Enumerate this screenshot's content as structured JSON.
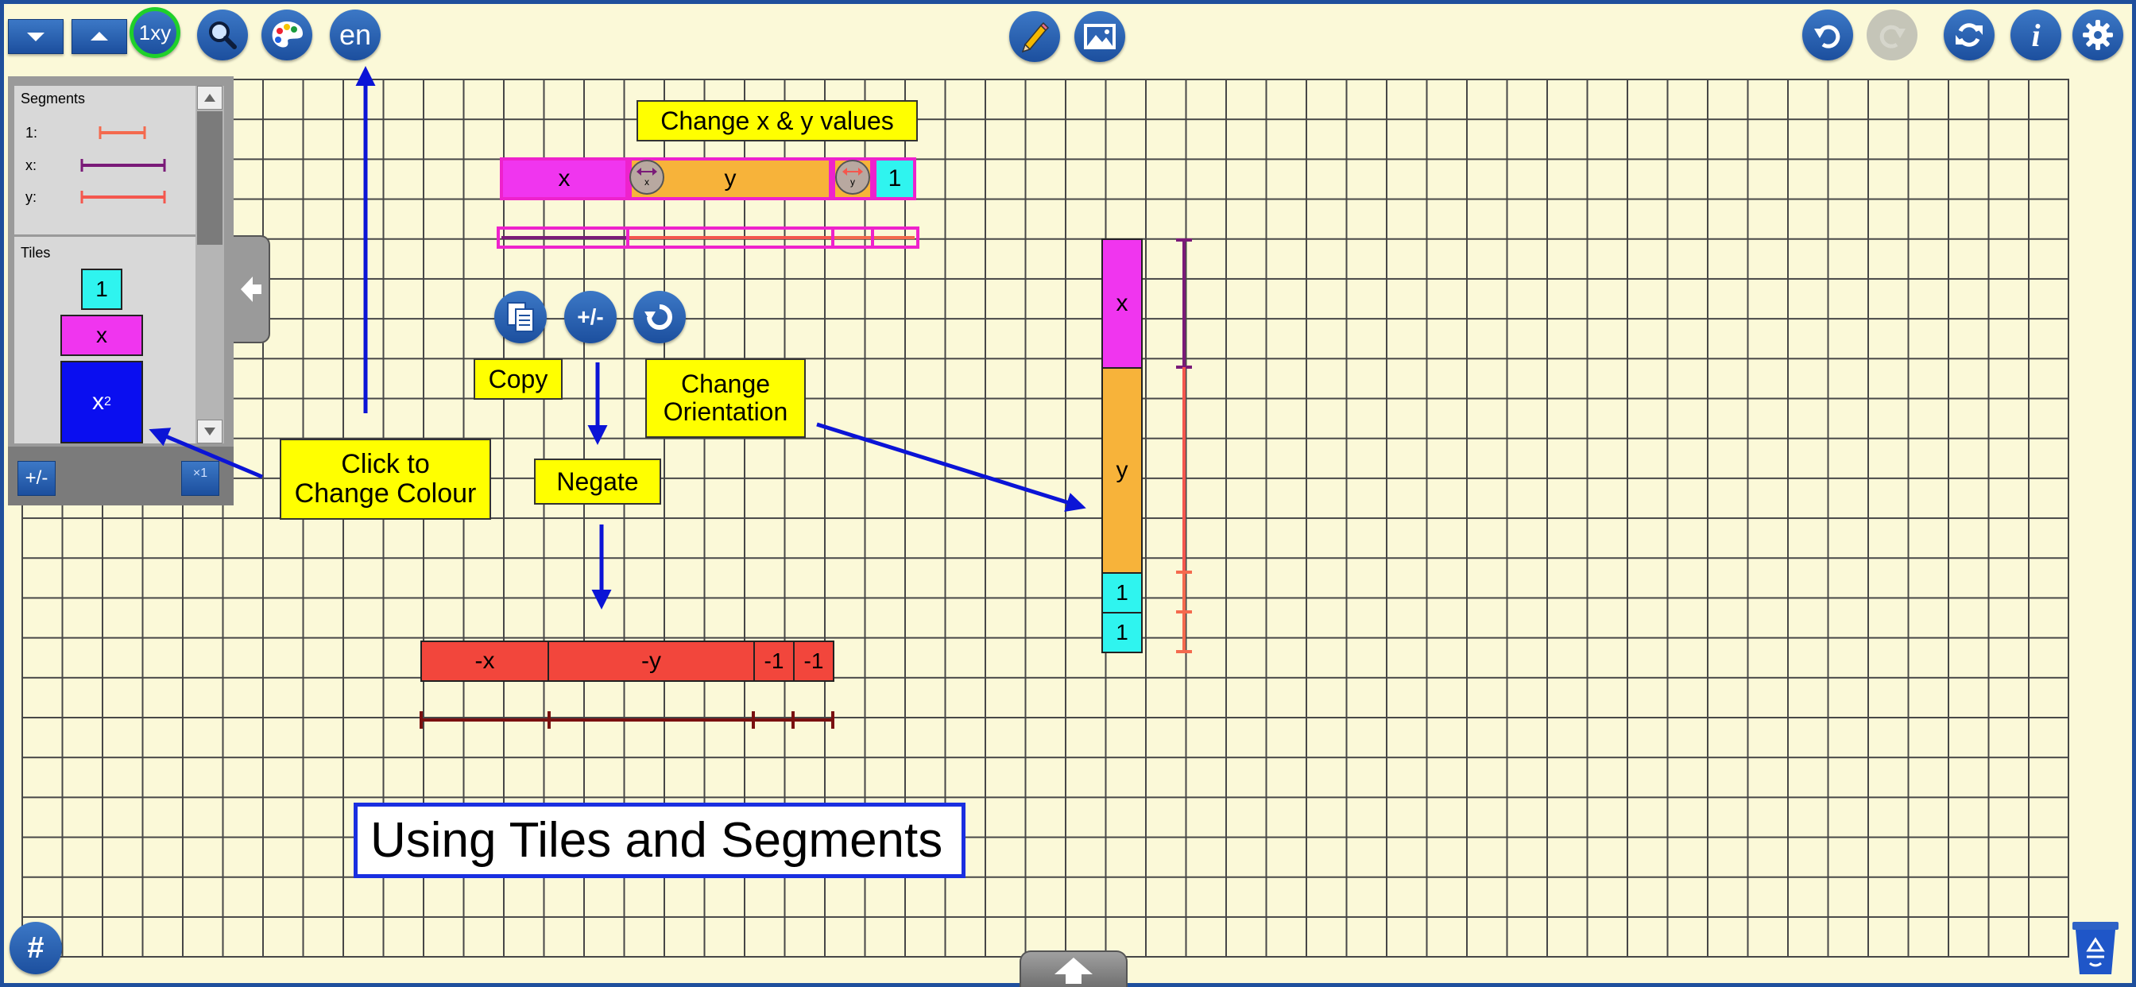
{
  "toolbar": {
    "expand_down_icon": "triangle-down-icon",
    "collapse_up_icon": "triangle-up-icon",
    "variables_button": "1xy",
    "language_button": "en"
  },
  "sidebar": {
    "segments_heading": "Segments",
    "segments": [
      {
        "label": "1:",
        "color": "#f46a4e"
      },
      {
        "label": "x:",
        "color": "#7a1a78"
      },
      {
        "label": "y:",
        "color": "#f4574e"
      }
    ],
    "tiles_heading": "Tiles",
    "tiles": [
      {
        "label": "1",
        "color": "#2ff4ef"
      },
      {
        "label": "x",
        "color": "#f035ef"
      },
      {
        "label": "x",
        "sup": "2",
        "color": "#0a0ef0"
      }
    ],
    "negate_button": "+/-",
    "multiplier_button": "×1"
  },
  "canvas": {
    "horizontal_row": {
      "tiles": [
        "x",
        "y",
        "1"
      ]
    },
    "negated_row": {
      "tiles": [
        "-x",
        "-y",
        "-1",
        "-1"
      ]
    },
    "vertical_column": {
      "tiles": [
        "x",
        "y",
        "1",
        "1"
      ]
    },
    "handle_x_label": "x",
    "handle_y_label": "y",
    "action_negate_label": "+/-",
    "title": "Using Tiles and Segments"
  },
  "notes": {
    "change_values": "Change x & y values",
    "copy": "Copy",
    "change_orientation_1": "Change",
    "change_orientation_2": "Orientation",
    "negate": "Negate",
    "click_colour_1": "Click to",
    "click_colour_2": "Change Colour"
  },
  "footer": {
    "grid_button": "#"
  },
  "colors": {
    "background": "#fbf9d8",
    "frame": "#1f4f9c",
    "tile_one": "#2ff4ef",
    "tile_x": "#f035ef",
    "tile_y": "#f7b33a",
    "negative": "#f2463c",
    "note": "#ffff00",
    "arrow": "#0b14d6"
  }
}
